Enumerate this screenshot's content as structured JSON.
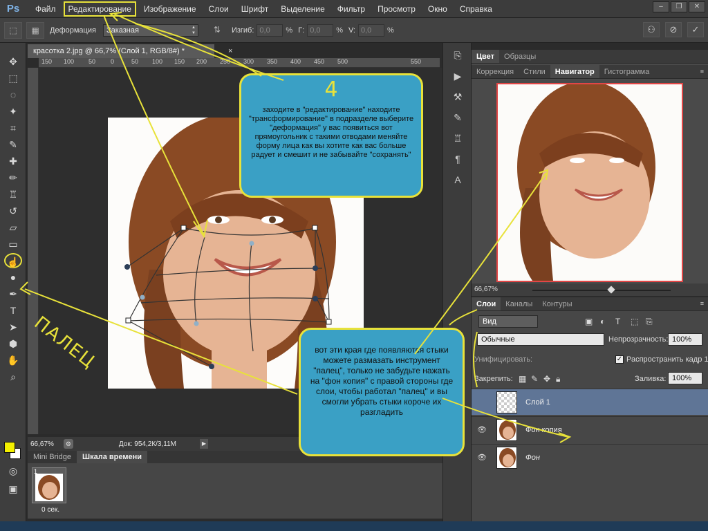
{
  "app": {
    "logo": "Ps"
  },
  "menu": {
    "items": [
      "Файл",
      "Редактирование",
      "Изображение",
      "Слои",
      "Шрифт",
      "Выделение",
      "Фильтр",
      "Просмотр",
      "Окно",
      "Справка"
    ],
    "active_index": 1
  },
  "options": {
    "mode_label": "Деформация",
    "preset_value": "Заказная",
    "bend_label": "Изгиб:",
    "bend_value": "0,0",
    "pct": "%",
    "h_label": "Г:",
    "h_value": "0,0",
    "v_label": "V:",
    "v_value": "0,0"
  },
  "document": {
    "tab_title": "красотка 2.jpg @ 66,7% (Слой 1, RGB/8#) *",
    "close": "×",
    "ruler_ticks": [
      "150",
      "100",
      "50",
      "0",
      "50",
      "100",
      "150",
      "200",
      "250",
      "300",
      "350",
      "400",
      "450",
      "500",
      "550"
    ],
    "zoom": "66,67%",
    "doc_info": "Док: 954,2К/3,11М"
  },
  "bottom_panel": {
    "tabs": [
      "Mini Bridge",
      "Шкала времени"
    ],
    "active_tab": 1,
    "frame_number": "1",
    "frame_time": "0 сек."
  },
  "panels": {
    "color_tabs": [
      "Цвет",
      "Образцы"
    ],
    "nav_tabs": [
      "Коррекция",
      "Стили",
      "Навигатор",
      "Гистограмма"
    ],
    "nav_active": 2,
    "nav_zoom": "66,67%",
    "layers_tabs": [
      "Слои",
      "Каналы",
      "Контуры"
    ],
    "kind_filter": "Вид",
    "blend_mode": "Обычные",
    "opacity_label": "Непрозрачность:",
    "opacity_value": "100%",
    "unify_label": "Унифицировать:",
    "propagate_label": "Распространить кадр 1",
    "lock_label": "Закрепить:",
    "fill_label": "Заливка:",
    "fill_value": "100%",
    "layers": [
      {
        "name": "Слой 1",
        "selected": true
      },
      {
        "name": "Фон копия",
        "selected": false
      },
      {
        "name": "Фон",
        "selected": false
      }
    ]
  },
  "annotations": {
    "step_number": "4",
    "step_text": "заходите в \"редактирование\" находите \"трансформирование\" в подразделе выберите \"деформация\" у вас появиться вот прямоугольник с такими отводами меняйте форму лица как вы хотите как вас больше радует и смешит и не забывайте \"сохранять\"",
    "tip_text": "вот эти края где появляются стыки можете размазать инструмент \"палец\", только не забудьте нажать на \"фон копия\" с правой стороны где слои, чтобы работал \"палец\" и вы смогли убрать стыки короче их разгладить",
    "palec_label": "ПАЛЕЦ"
  },
  "colors": {
    "accent": "#e8e23a",
    "bubble": "#3aa0c5",
    "selected_layer": "#5f7596",
    "foreground": "#f4f000",
    "background": "#ffffff"
  }
}
